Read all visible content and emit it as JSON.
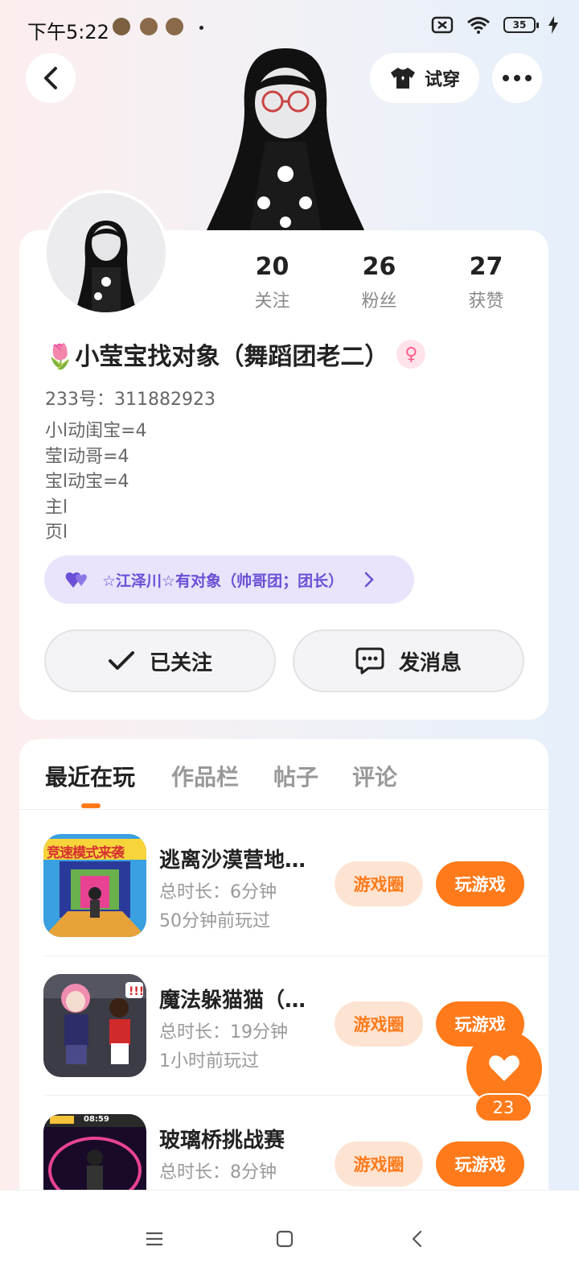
{
  "status_bar": {
    "time": "下午5:22",
    "battery": "35"
  },
  "header": {
    "tryon_label": "试穿"
  },
  "stats": [
    {
      "value": "20",
      "label": "关注"
    },
    {
      "value": "26",
      "label": "粉丝"
    },
    {
      "value": "27",
      "label": "获赞"
    }
  ],
  "profile": {
    "nickname": "🌷小莹宝找对象（舞蹈团老二）",
    "gender_symbol": "♀",
    "uid": "233号：311882923",
    "bio": [
      "小l动闺宝=4",
      "莹l动哥=4",
      "宝l动宝=4",
      "主l",
      "页l"
    ],
    "cp_text": "☆江泽川☆有对象（帅哥团；团长）"
  },
  "actions": {
    "follow_label": "已关注",
    "message_label": "发消息"
  },
  "tabs": [
    {
      "label": "最近在玩",
      "active": true
    },
    {
      "label": "作品栏",
      "active": false
    },
    {
      "label": "帖子",
      "active": false
    },
    {
      "label": "评论",
      "active": false
    }
  ],
  "games": [
    {
      "title": "逃离沙漠营地…",
      "duration": "总时长：6分钟",
      "last_played": "50分钟前玩过",
      "thumb_text": "竞速模式来袭"
    },
    {
      "title": "魔法躲猫猫（…",
      "duration": "总时长：19分钟",
      "last_played": "1小时前玩过",
      "thumb_text": ""
    },
    {
      "title": "玻璃桥挑战赛",
      "duration": "总时长：8分钟",
      "last_played": "",
      "thumb_text": "08:59"
    }
  ],
  "game_buttons": {
    "circle_label": "游戏圈",
    "play_label": "玩游戏"
  },
  "fab": {
    "count": "23"
  },
  "colors": {
    "accent": "#ff7a1a",
    "accent_light": "#fde4d2",
    "cp_purple": "#6b4fd6"
  }
}
